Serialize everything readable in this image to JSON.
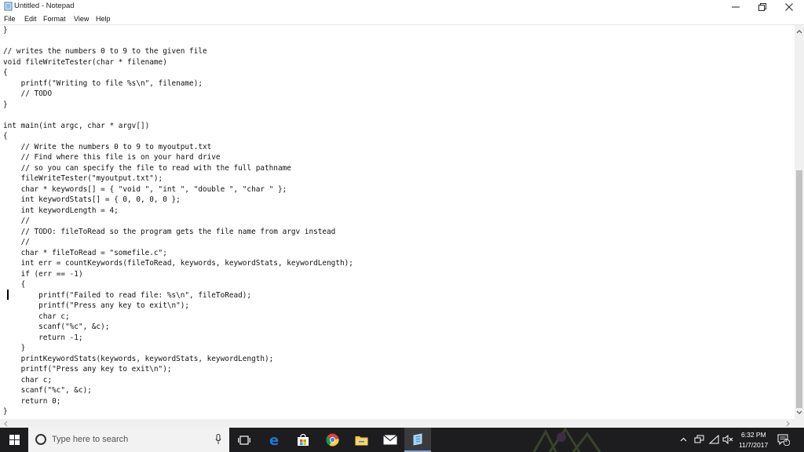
{
  "window": {
    "title": "Untitled - Notepad"
  },
  "menu": [
    "File",
    "Edit",
    "Format",
    "View",
    "Help"
  ],
  "editor": {
    "lines": [
      "}",
      "",
      "// writes the numbers 0 to 9 to the given file",
      "void fileWriteTester(char * filename)",
      "{",
      "    printf(\"Writing to file %s\\n\", filename);",
      "    // TODO",
      "}",
      "",
      "int main(int argc, char * argv[])",
      "{",
      "    // Write the numbers 0 to 9 to myoutput.txt",
      "    // Find where this file is on your hard drive",
      "    // so you can specify the file to read with the full pathname",
      "    fileWriteTester(\"myoutput.txt\");",
      "    char * keywords[] = { \"void \", \"int \", \"double \", \"char \" };",
      "    int keywordStats[] = { 0, 0, 0, 0 };",
      "    int keywordLength = 4;",
      "    //",
      "    // TODO: fileToRead so the program gets the file name from argv instead",
      "    //",
      "    char * fileToRead = \"somefile.c\";",
      "    int err = countKeywords(fileToRead, keywords, keywordStats, keywordLength);",
      "    if (err == -1)",
      "    {",
      "        printf(\"Failed to read file: %s\\n\", fileToRead);",
      "        printf(\"Press any key to exit\\n\");",
      "        char c;",
      "        scanf(\"%c\", &c);",
      "        return -1;",
      "    }",
      "    printKeywordStats(keywords, keywordStats, keywordLength);",
      "    printf(\"Press any key to exit\\n\");",
      "    char c;",
      "    scanf(\"%c\", &c);",
      "    return 0;",
      "}"
    ]
  },
  "taskbar": {
    "search_placeholder": "Type here to search",
    "apps": [
      "task-view",
      "edge",
      "store",
      "chrome",
      "file-explorer",
      "mail",
      "notepad"
    ],
    "clock_time": "6:32 PM",
    "clock_date": "11/7/2017",
    "notification_count": "1"
  },
  "colors": {
    "taskbar_bg": "#1d1d1f",
    "edge_blue": "#1e78d6",
    "folder_yellow": "#f6c343",
    "scroll_thumb": "#c2c2c2"
  }
}
